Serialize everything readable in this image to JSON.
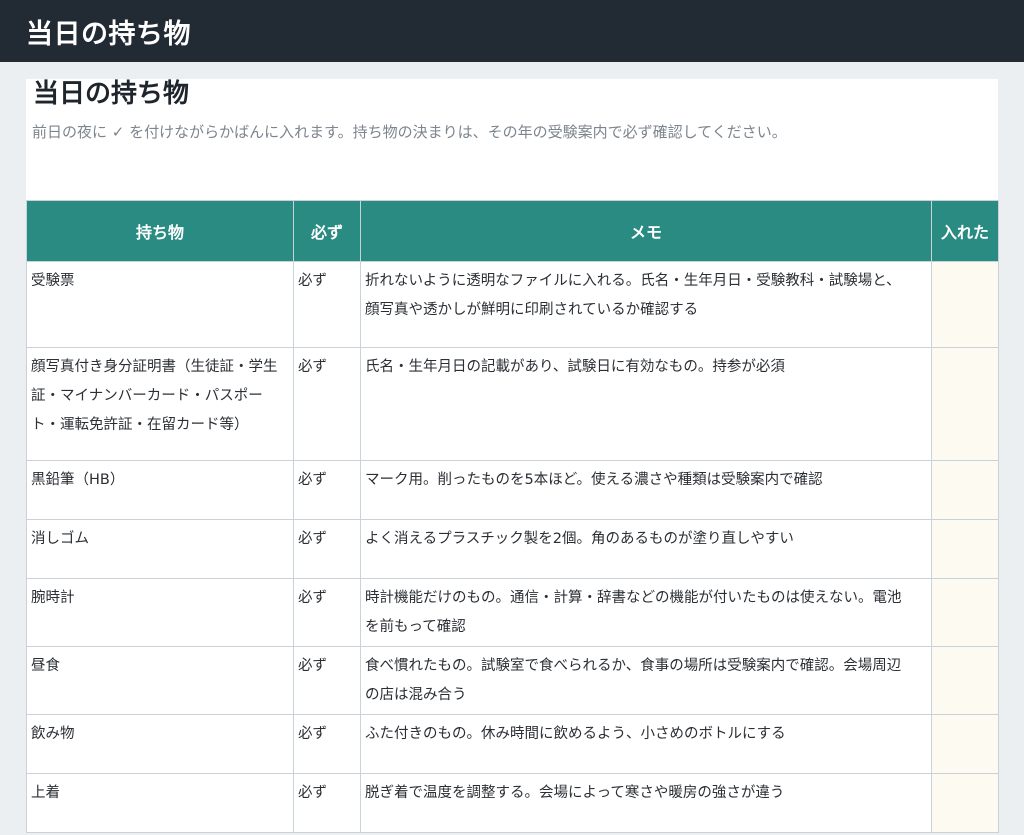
{
  "header": {
    "title": "当日の持ち物"
  },
  "sheet": {
    "title": "当日の持ち物",
    "description": "前日の夜に ✓ を付けながらかばんに入れます。持ち物の決まりは、その年の受験案内で必ず確認してください。"
  },
  "table": {
    "columns": [
      "持ち物",
      "必ず",
      "メモ",
      "入れた"
    ],
    "rows": [
      {
        "item": "受験票",
        "required": "必ず",
        "memo": "折れないように透明なファイルに入れる。氏名・生年月日・受験教科・試験場と、顔写真や透かしが鮮明に印刷されているか確認する",
        "checked": ""
      },
      {
        "item": "顔写真付き身分証明書（生徒証・学生証・マイナンバーカード・パスポート・運転免許証・在留カード等）",
        "required": "必ず",
        "memo": "氏名・生年月日の記載があり、試験日に有効なもの。持参が必須",
        "checked": ""
      },
      {
        "item": "黒鉛筆（HB）",
        "required": "必ず",
        "memo": "マーク用。削ったものを5本ほど。使える濃さや種類は受験案内で確認",
        "checked": ""
      },
      {
        "item": "消しゴム",
        "required": "必ず",
        "memo": "よく消えるプラスチック製を2個。角のあるものが塗り直しやすい",
        "checked": ""
      },
      {
        "item": "腕時計",
        "required": "必ず",
        "memo": "時計機能だけのもの。通信・計算・辞書などの機能が付いたものは使えない。電池を前もって確認",
        "checked": ""
      },
      {
        "item": "昼食",
        "required": "必ず",
        "memo": "食べ慣れたもの。試験室で食べられるか、食事の場所は受験案内で確認。会場周辺の店は混み合う",
        "checked": ""
      },
      {
        "item": "飲み物",
        "required": "必ず",
        "memo": "ふた付きのもの。休み時間に飲めるよう、小さめのボトルにする",
        "checked": ""
      },
      {
        "item": "上着",
        "required": "必ず",
        "memo": "脱ぎ着で温度を調整する。会場によって寒さや暖房の強さが違う",
        "checked": ""
      }
    ]
  }
}
